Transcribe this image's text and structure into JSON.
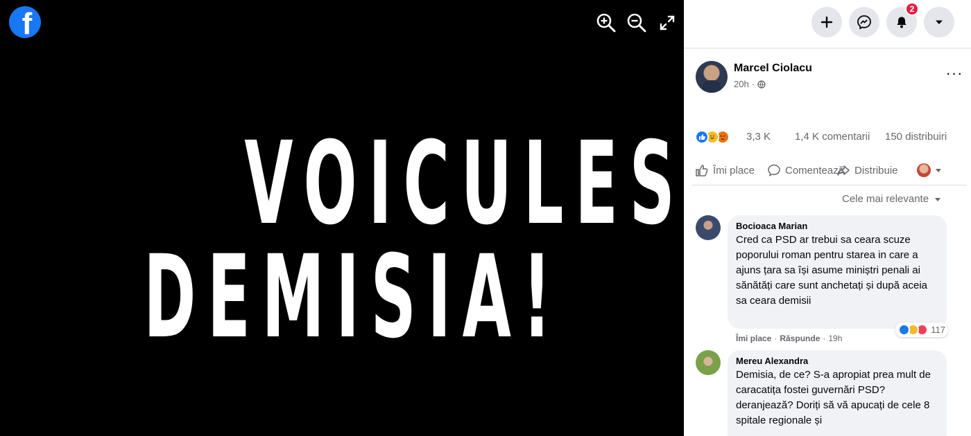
{
  "viewer": {
    "headline_line1": "VOICULESCU,",
    "headline_line2": "DEMISIA!",
    "tools": [
      "zoom-in-icon",
      "zoom-out-icon",
      "fullscreen-icon"
    ]
  },
  "topbar": {
    "notifications_count": "2",
    "buttons": [
      "plus-icon",
      "messenger-icon",
      "bell-icon",
      "caret-down-icon"
    ]
  },
  "post": {
    "author": "Marcel Ciolacu",
    "time": "20h",
    "privacy_icon": "globe-icon",
    "reactions_count": "3,3 K",
    "comments": "1,4 K comentarii",
    "shares": "150 distribuiri",
    "actions": {
      "like": "Îmi place",
      "comment": "Comentează",
      "share": "Distribuie"
    },
    "sort_label": "Cele mai relevante"
  },
  "comments": [
    {
      "name": "Bocioaca Marian",
      "text": "Cred ca PSD ar trebui sa ceara scuze poporului roman pentru starea in care a ajuns țara sa își asume miniștri penali ai sănătăți care sunt anchetați și după aceia sa ceara demisii",
      "reactions": "117",
      "like": "Îmi place",
      "reply": "Răspunde",
      "time": "19h"
    },
    {
      "name": "Mereu Alexandra",
      "text": "Demisia, de ce? S-a apropiat prea mult de caracatița fostei guvernări PSD? deranjează? Doriți să vă apucați de cele 8 spitale regionale și"
    }
  ],
  "colors": {
    "facebook_blue": "#1877f2",
    "badge_red": "#e41e3f",
    "bubble_gray": "#f0f2f5"
  }
}
